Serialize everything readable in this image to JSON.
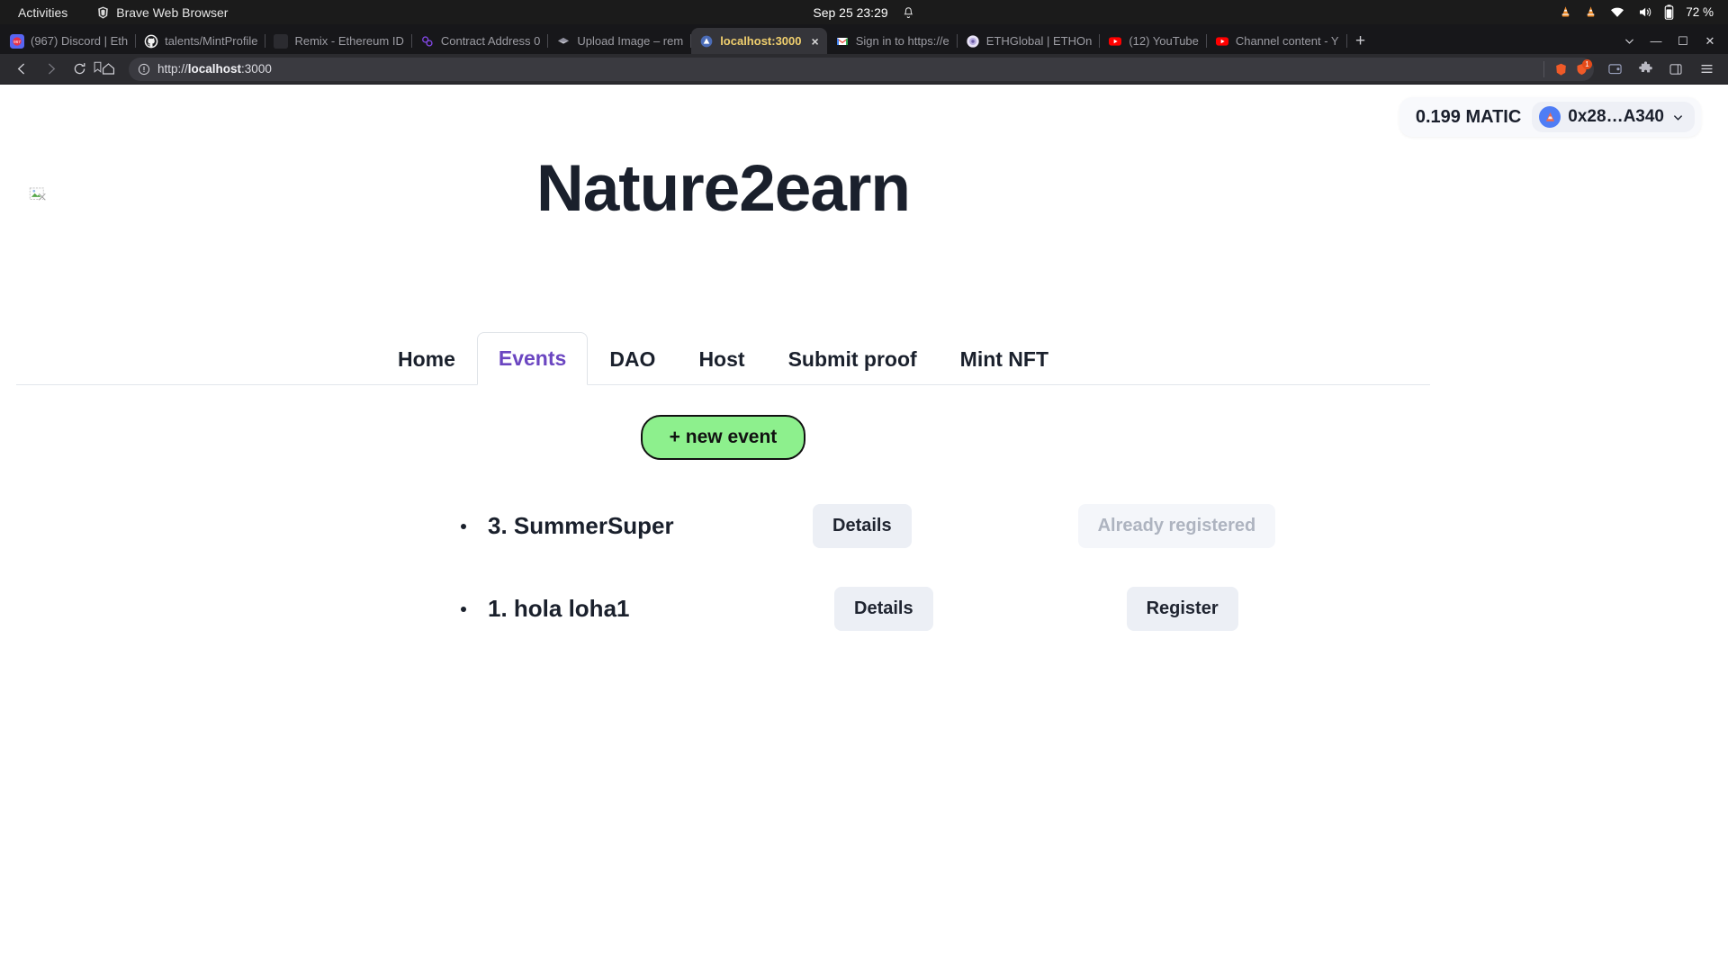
{
  "os_bar": {
    "activities": "Activities",
    "app_name": "Brave Web Browser",
    "app_icon": "brave-lion-icon",
    "clock": "Sep 25  23:29",
    "bell_icon": "bell-icon",
    "tray": {
      "icon1": "vlc-cone-icon",
      "icon2": "vlc-cone-icon",
      "wifi_icon": "wifi-icon",
      "volume_icon": "volume-icon",
      "battery_icon": "battery-icon",
      "battery_label": "72 %"
    }
  },
  "browser": {
    "tabs": [
      {
        "title": "(967) Discord | Eth",
        "favicon": "discord-icon",
        "active": false
      },
      {
        "title": "talents/MintProfile",
        "favicon": "github-icon",
        "active": false
      },
      {
        "title": "Remix - Ethereum ID",
        "favicon": "remix-icon",
        "active": false
      },
      {
        "title": "Contract Address 0",
        "favicon": "polygonscan-icon",
        "active": false
      },
      {
        "title": "Upload Image – rem",
        "favicon": "diamond-icon",
        "active": false
      },
      {
        "title": "localhost:3000",
        "favicon": "nextjs-warning-icon",
        "active": true,
        "close_label": "×"
      },
      {
        "title": "Sign in to https://e",
        "favicon": "gmail-icon",
        "active": false
      },
      {
        "title": "ETHGlobal | ETHOn",
        "favicon": "ethglobal-icon",
        "active": false
      },
      {
        "title": "(12) YouTube",
        "favicon": "youtube-icon",
        "active": false
      },
      {
        "title": "Channel content - Y",
        "favicon": "youtube-icon",
        "active": false
      }
    ],
    "new_tab_label": "+",
    "window_controls": {
      "minimize": "—",
      "maximize": "☐",
      "close": "✕"
    },
    "nav": {
      "back_icon": "back-arrow-icon",
      "forward_icon": "forward-arrow-icon",
      "reload_icon": "reload-icon",
      "home_icon": "home-icon",
      "bookmark_icon": "bookmark-icon",
      "security_icon": "info-circle-icon"
    },
    "url": {
      "scheme": "http://",
      "host": "localhost",
      "port": ":3000",
      "full": "http://localhost:3000"
    },
    "toolbar_right": {
      "brave_rewards_icon": "brave-lion-icon",
      "shields_icon": "brave-shields-icon",
      "shields_badge": "1",
      "wallet_icon": "brave-wallet-icon",
      "extensions_icon": "puzzle-icon",
      "sidebar_icon": "sidebar-icon",
      "menu_icon": "hamburger-menu-icon"
    }
  },
  "page": {
    "logo": {
      "icon": "broken-image-icon",
      "alt": ""
    },
    "title": "Nature2earn",
    "wallet": {
      "balance": "0.199 MATIC",
      "address": "0x28…A340",
      "avatar_icon": "wallet-avatar-icon",
      "chevron_icon": "chevron-down-icon"
    },
    "nav_tabs": [
      {
        "label": "Home",
        "active": false
      },
      {
        "label": "Events",
        "active": true
      },
      {
        "label": "DAO",
        "active": false
      },
      {
        "label": "Host",
        "active": false
      },
      {
        "label": "Submit proof",
        "active": false
      },
      {
        "label": "Mint NFT",
        "active": false
      }
    ],
    "new_event_button": "+ new event",
    "events": [
      {
        "name": "3. SummerSuper",
        "details_label": "Details",
        "action_label": "Already registered",
        "action_disabled": true
      },
      {
        "name": "1. hola loha1",
        "details_label": "Details",
        "action_label": "Register",
        "action_disabled": false
      }
    ]
  },
  "colors": {
    "accent_purple": "#6b46c1",
    "button_green": "#8df08d",
    "title_dark": "#1a202c",
    "button_grey": "#eceff5",
    "tab_active_yellow": "#f0cf6e"
  }
}
